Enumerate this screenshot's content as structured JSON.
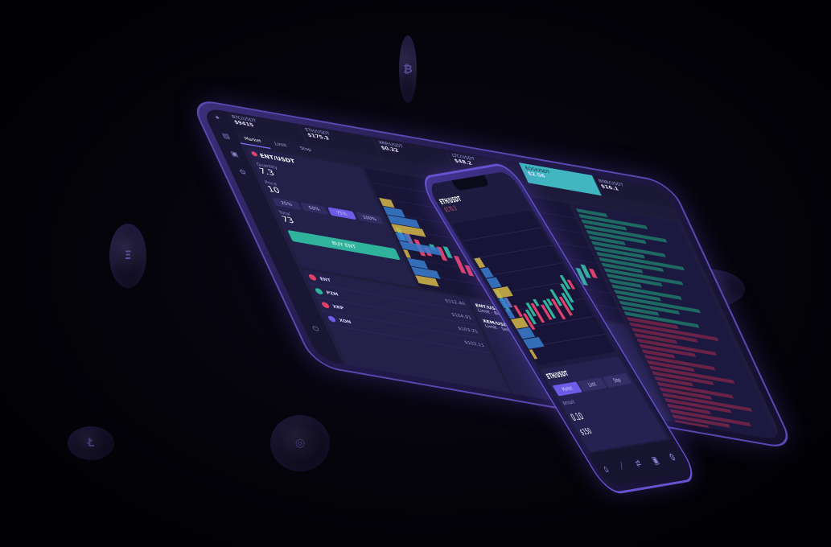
{
  "tablet": {
    "sidebar_icons": [
      "logo-icon",
      "chart-icon",
      "wallet-icon",
      "settings-icon",
      "power-icon"
    ],
    "tickers": [
      {
        "label": "BTC/USDT",
        "value": "$9415"
      },
      {
        "label": "ETH/USDT",
        "value": "$175.3"
      },
      {
        "label": "XRP/USDT",
        "value": "$0.22"
      },
      {
        "label": "LTC/USDT",
        "value": "$48.2"
      },
      {
        "label": "EOS/USDT",
        "value": "$2.56"
      },
      {
        "label": "BNB/USDT",
        "value": "$16.1"
      }
    ],
    "tabs": [
      "Market",
      "Limit",
      "Stop"
    ],
    "order": {
      "pair": "ENT/USDT",
      "qty_label": "Quantity",
      "qty_value": "7.3",
      "price_label": "Price",
      "price_value": "10",
      "total_label": "Total",
      "total_value": "73",
      "segments": [
        "25%",
        "50%",
        "75%",
        "100%"
      ],
      "buy": "BUY ENT",
      "sell": "SELL ENT"
    },
    "assets": [
      {
        "name": "ENT",
        "price": "$112.40",
        "color": "#e0416a"
      },
      {
        "name": "PZM",
        "price": "$104.91",
        "color": "#2fb39c"
      },
      {
        "name": "XRP",
        "price": "$103.25",
        "color": "#e0416a"
      },
      {
        "name": "XDN",
        "price": "$102.11",
        "color": "#6c5ce7"
      }
    ],
    "open_orders": [
      {
        "pair": "ENT/USDT",
        "detail": "Limit · Buy · 7.3"
      },
      {
        "pair": "XEM/USDT",
        "detail": "Limit · Sell · 12.0"
      }
    ]
  },
  "phone": {
    "pair": "ETH/USDT",
    "price": "$170.3",
    "form": {
      "pair": "ETH/USDT",
      "segments": [
        "Market",
        "Limit",
        "Stop"
      ],
      "amount": "0.10",
      "amount_label": "Amount",
      "total": "$150"
    },
    "nav_icons": [
      "home-icon",
      "chart-icon",
      "trade-icon",
      "wallet-icon",
      "settings-icon"
    ]
  },
  "coins": [
    {
      "glyph": "₿"
    },
    {
      "glyph": "Ξ"
    },
    {
      "glyph": "◈"
    },
    {
      "glyph": "Ł"
    },
    {
      "glyph": "◎"
    },
    {
      "glyph": "✦"
    }
  ],
  "colors": {
    "accent": "#6c5ce7",
    "green": "#2fb39c",
    "red": "#e0416a",
    "teal": "#3fb6c0",
    "bg": "#020106"
  }
}
